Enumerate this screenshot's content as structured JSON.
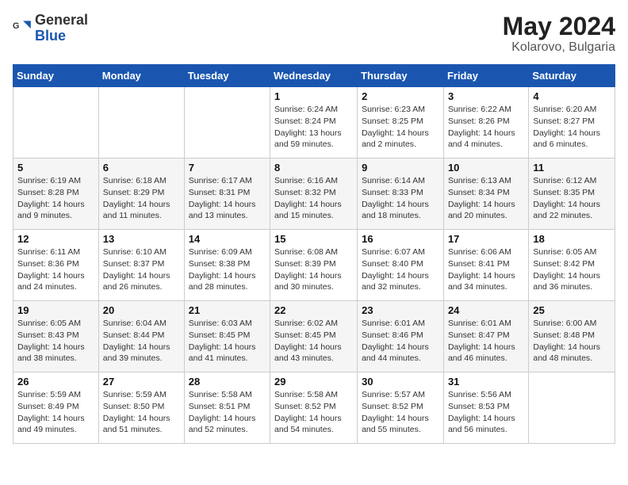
{
  "header": {
    "logo_general": "General",
    "logo_blue": "Blue",
    "month_title": "May 2024",
    "location": "Kolarovo, Bulgaria"
  },
  "weekdays": [
    "Sunday",
    "Monday",
    "Tuesday",
    "Wednesday",
    "Thursday",
    "Friday",
    "Saturday"
  ],
  "weeks": [
    [
      {
        "day": "",
        "info": ""
      },
      {
        "day": "",
        "info": ""
      },
      {
        "day": "",
        "info": ""
      },
      {
        "day": "1",
        "info": "Sunrise: 6:24 AM\nSunset: 8:24 PM\nDaylight: 13 hours\nand 59 minutes."
      },
      {
        "day": "2",
        "info": "Sunrise: 6:23 AM\nSunset: 8:25 PM\nDaylight: 14 hours\nand 2 minutes."
      },
      {
        "day": "3",
        "info": "Sunrise: 6:22 AM\nSunset: 8:26 PM\nDaylight: 14 hours\nand 4 minutes."
      },
      {
        "day": "4",
        "info": "Sunrise: 6:20 AM\nSunset: 8:27 PM\nDaylight: 14 hours\nand 6 minutes."
      }
    ],
    [
      {
        "day": "5",
        "info": "Sunrise: 6:19 AM\nSunset: 8:28 PM\nDaylight: 14 hours\nand 9 minutes."
      },
      {
        "day": "6",
        "info": "Sunrise: 6:18 AM\nSunset: 8:29 PM\nDaylight: 14 hours\nand 11 minutes."
      },
      {
        "day": "7",
        "info": "Sunrise: 6:17 AM\nSunset: 8:31 PM\nDaylight: 14 hours\nand 13 minutes."
      },
      {
        "day": "8",
        "info": "Sunrise: 6:16 AM\nSunset: 8:32 PM\nDaylight: 14 hours\nand 15 minutes."
      },
      {
        "day": "9",
        "info": "Sunrise: 6:14 AM\nSunset: 8:33 PM\nDaylight: 14 hours\nand 18 minutes."
      },
      {
        "day": "10",
        "info": "Sunrise: 6:13 AM\nSunset: 8:34 PM\nDaylight: 14 hours\nand 20 minutes."
      },
      {
        "day": "11",
        "info": "Sunrise: 6:12 AM\nSunset: 8:35 PM\nDaylight: 14 hours\nand 22 minutes."
      }
    ],
    [
      {
        "day": "12",
        "info": "Sunrise: 6:11 AM\nSunset: 8:36 PM\nDaylight: 14 hours\nand 24 minutes."
      },
      {
        "day": "13",
        "info": "Sunrise: 6:10 AM\nSunset: 8:37 PM\nDaylight: 14 hours\nand 26 minutes."
      },
      {
        "day": "14",
        "info": "Sunrise: 6:09 AM\nSunset: 8:38 PM\nDaylight: 14 hours\nand 28 minutes."
      },
      {
        "day": "15",
        "info": "Sunrise: 6:08 AM\nSunset: 8:39 PM\nDaylight: 14 hours\nand 30 minutes."
      },
      {
        "day": "16",
        "info": "Sunrise: 6:07 AM\nSunset: 8:40 PM\nDaylight: 14 hours\nand 32 minutes."
      },
      {
        "day": "17",
        "info": "Sunrise: 6:06 AM\nSunset: 8:41 PM\nDaylight: 14 hours\nand 34 minutes."
      },
      {
        "day": "18",
        "info": "Sunrise: 6:05 AM\nSunset: 8:42 PM\nDaylight: 14 hours\nand 36 minutes."
      }
    ],
    [
      {
        "day": "19",
        "info": "Sunrise: 6:05 AM\nSunset: 8:43 PM\nDaylight: 14 hours\nand 38 minutes."
      },
      {
        "day": "20",
        "info": "Sunrise: 6:04 AM\nSunset: 8:44 PM\nDaylight: 14 hours\nand 39 minutes."
      },
      {
        "day": "21",
        "info": "Sunrise: 6:03 AM\nSunset: 8:45 PM\nDaylight: 14 hours\nand 41 minutes."
      },
      {
        "day": "22",
        "info": "Sunrise: 6:02 AM\nSunset: 8:45 PM\nDaylight: 14 hours\nand 43 minutes."
      },
      {
        "day": "23",
        "info": "Sunrise: 6:01 AM\nSunset: 8:46 PM\nDaylight: 14 hours\nand 44 minutes."
      },
      {
        "day": "24",
        "info": "Sunrise: 6:01 AM\nSunset: 8:47 PM\nDaylight: 14 hours\nand 46 minutes."
      },
      {
        "day": "25",
        "info": "Sunrise: 6:00 AM\nSunset: 8:48 PM\nDaylight: 14 hours\nand 48 minutes."
      }
    ],
    [
      {
        "day": "26",
        "info": "Sunrise: 5:59 AM\nSunset: 8:49 PM\nDaylight: 14 hours\nand 49 minutes."
      },
      {
        "day": "27",
        "info": "Sunrise: 5:59 AM\nSunset: 8:50 PM\nDaylight: 14 hours\nand 51 minutes."
      },
      {
        "day": "28",
        "info": "Sunrise: 5:58 AM\nSunset: 8:51 PM\nDaylight: 14 hours\nand 52 minutes."
      },
      {
        "day": "29",
        "info": "Sunrise: 5:58 AM\nSunset: 8:52 PM\nDaylight: 14 hours\nand 54 minutes."
      },
      {
        "day": "30",
        "info": "Sunrise: 5:57 AM\nSunset: 8:52 PM\nDaylight: 14 hours\nand 55 minutes."
      },
      {
        "day": "31",
        "info": "Sunrise: 5:56 AM\nSunset: 8:53 PM\nDaylight: 14 hours\nand 56 minutes."
      },
      {
        "day": "",
        "info": ""
      }
    ]
  ]
}
